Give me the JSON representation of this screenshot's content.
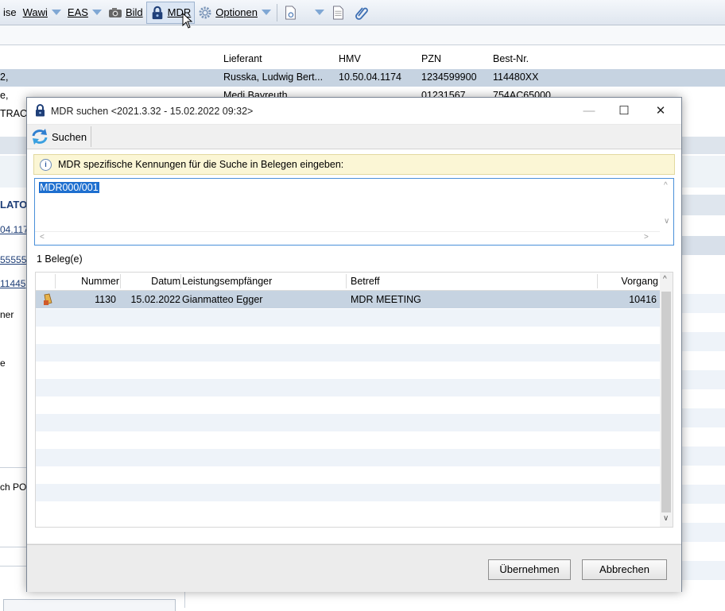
{
  "toolbar": {
    "items": [
      {
        "label": "ise"
      },
      {
        "label": "Wawi"
      },
      {
        "label": "EAS"
      },
      {
        "label": "Bild"
      },
      {
        "label": "MDR"
      },
      {
        "label": "Optionen"
      }
    ]
  },
  "bg_table": {
    "headers": [
      "Lieferant",
      "HMV",
      "PZN",
      "Best-Nr."
    ],
    "rows": [
      {
        "left": "2,",
        "lieferant": "Russka, Ludwig Bert...",
        "hmv": "10.50.04.1174",
        "pzn": "1234599900",
        "best": "114480XX"
      },
      {
        "left": "e,",
        "lieferant": "Medi Bayreuth",
        "hmv": "",
        "pzn": "01231567",
        "best": "754AC65000"
      },
      {
        "left": "TRAC",
        "lieferant": "",
        "hmv": "",
        "pzn": "",
        "best": ""
      }
    ],
    "left_fragments": [
      "LATO",
      "04.117",
      "55555",
      "11445",
      "ner",
      "e",
      "ch PO"
    ]
  },
  "dialog": {
    "title": "MDR suchen <2021.3.32 - 15.02.2022 09:32>",
    "minimize": "—",
    "maximize": "☐",
    "close": "✕",
    "toolbar": {
      "search_label": "Suchen"
    },
    "hint": "MDR spezifische Kennungen für die Suche in Belegen eingeben:",
    "input_value": "MDR000/001",
    "count_label": "1 Beleg(e)",
    "columns": [
      "Nummer",
      "Datum",
      "Leistungsempfänger",
      "Betreff",
      "Vorgang"
    ],
    "rows": [
      {
        "nummer": "1130",
        "datum": "15.02.2022",
        "empfaenger": "Gianmatteo Egger",
        "betreff": "MDR MEETING",
        "vorgang": "10416"
      }
    ],
    "buttons": {
      "apply": "Übernehmen",
      "cancel": "Abbrechen"
    }
  },
  "colors": {
    "accent": "#1e6fcf",
    "selected_row": "#c6d3e1",
    "hint_bg": "#fbf6d5"
  }
}
